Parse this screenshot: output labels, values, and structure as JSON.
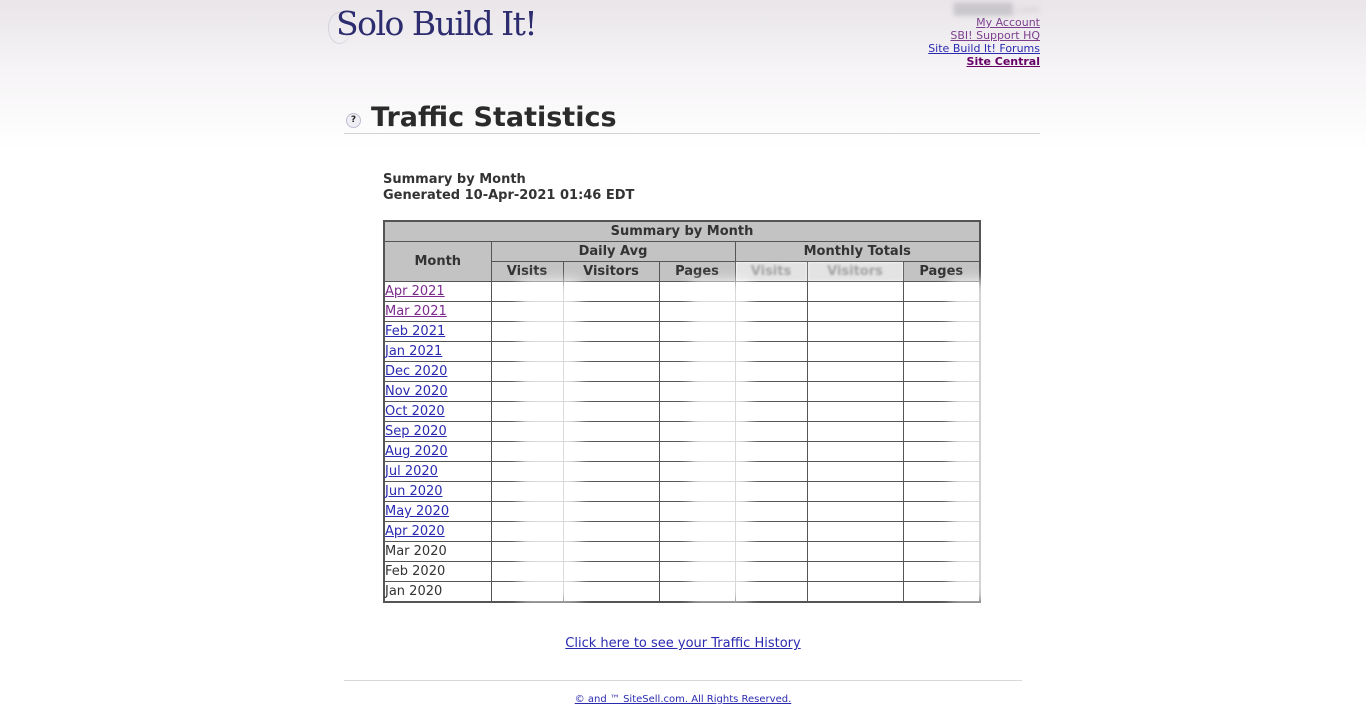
{
  "header": {
    "logo_text": "Solo Build It!",
    "domain_text": "███████.com",
    "links": {
      "my_account": "My Account",
      "support": "SBI! Support HQ",
      "forums": "Site Build It! Forums",
      "site_central": "Site Central"
    }
  },
  "page": {
    "title": "Traffic Statistics",
    "help_icon": "?",
    "summary_title": "Summary by Month",
    "generated": "Generated 10-Apr-2021 01:46 EDT"
  },
  "table": {
    "caption": "Summary by Month",
    "month_header": "Month",
    "daily_avg_header": "Daily Avg",
    "monthly_totals_header": "Monthly Totals",
    "col_visits": "Visits",
    "col_visitors": "Visitors",
    "col_pages": "Pages",
    "rows": [
      {
        "month": "Apr 2021",
        "linked": true,
        "visited": true
      },
      {
        "month": "Mar 2021",
        "linked": true,
        "visited": true
      },
      {
        "month": "Feb 2021",
        "linked": true,
        "visited": false
      },
      {
        "month": "Jan 2021",
        "linked": true,
        "visited": false
      },
      {
        "month": "Dec 2020",
        "linked": true,
        "visited": false
      },
      {
        "month": "Nov 2020",
        "linked": true,
        "visited": false
      },
      {
        "month": "Oct 2020",
        "linked": true,
        "visited": false
      },
      {
        "month": "Sep 2020",
        "linked": true,
        "visited": false
      },
      {
        "month": "Aug 2020",
        "linked": true,
        "visited": false
      },
      {
        "month": "Jul 2020",
        "linked": true,
        "visited": false
      },
      {
        "month": "Jun 2020",
        "linked": true,
        "visited": false
      },
      {
        "month": "May 2020",
        "linked": true,
        "visited": false
      },
      {
        "month": "Apr 2020",
        "linked": true,
        "visited": false
      },
      {
        "month": "Mar 2020",
        "linked": false,
        "visited": false
      },
      {
        "month": "Feb 2020",
        "linked": false,
        "visited": false
      },
      {
        "month": "Jan 2020",
        "linked": false,
        "visited": false
      }
    ]
  },
  "history_link": "Click here to see your Traffic History",
  "footer": "© and ™ SiteSell.com.  All Rights Reserved.",
  "colors": {
    "visits": "#ffff00",
    "visitors": "#ff7f27",
    "pages": "#00e5ff",
    "header_gray": "#c3c3c3",
    "link": "#2a2ab0",
    "visited_link": "#7c2a8e"
  }
}
